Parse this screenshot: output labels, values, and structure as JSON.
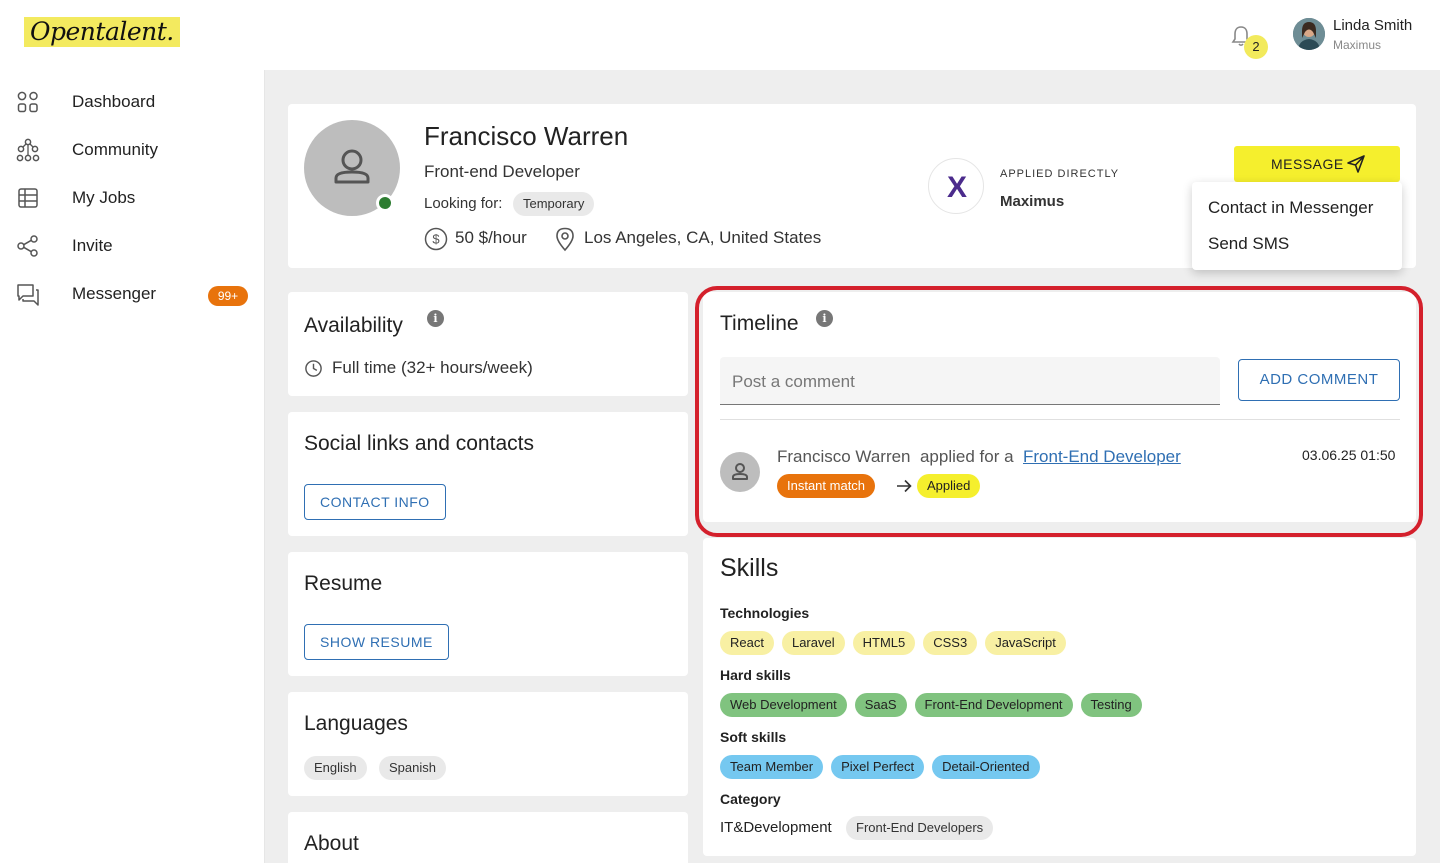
{
  "header": {
    "logo_text": "Opentalent.",
    "notification_count": "2",
    "user_name": "Linda Smith",
    "user_org": "Maximus"
  },
  "sidebar": {
    "items": [
      {
        "label": "Dashboard",
        "icon": "dashboard-icon"
      },
      {
        "label": "Community",
        "icon": "community-icon"
      },
      {
        "label": "My Jobs",
        "icon": "jobs-icon"
      },
      {
        "label": "Invite",
        "icon": "share-icon"
      },
      {
        "label": "Messenger",
        "icon": "messenger-icon",
        "badge": "99+"
      }
    ]
  },
  "profile": {
    "name": "Francisco Warren",
    "role": "Front-end Developer",
    "looking_for_label": "Looking for:",
    "looking_for_value": "Temporary",
    "rate": "50 $/hour",
    "location": "Los Angeles, CA, United States",
    "status": "online",
    "applied_label": "APPLIED DIRECTLY",
    "company": "Maximus",
    "company_logo_letter": "X",
    "message_button": "MESSAGE"
  },
  "message_menu": {
    "items": [
      "Contact in Messenger",
      "Send SMS"
    ]
  },
  "availability": {
    "title": "Availability",
    "value": "Full time (32+ hours/week)"
  },
  "social": {
    "title": "Social links and contacts",
    "button": "CONTACT INFO"
  },
  "resume": {
    "title": "Resume",
    "button": "SHOW RESUME"
  },
  "languages": {
    "title": "Languages",
    "items": [
      "English",
      "Spanish"
    ]
  },
  "about": {
    "title": "About"
  },
  "timeline": {
    "title": "Timeline",
    "comment_placeholder": "Post a comment",
    "add_comment_button": "ADD COMMENT",
    "event": {
      "actor": "Francisco Warren",
      "action": "applied for a",
      "job_link": "Front-End Developer",
      "date": "03.06.25 01:50",
      "from_status": "Instant match",
      "to_status": "Applied"
    }
  },
  "skills": {
    "title": "Skills",
    "technologies_label": "Technologies",
    "technologies": [
      "React",
      "Laravel",
      "HTML5",
      "CSS3",
      "JavaScript"
    ],
    "hard_label": "Hard skills",
    "hard": [
      "Web Development",
      "SaaS",
      "Front-End Development",
      "Testing"
    ],
    "soft_label": "Soft skills",
    "soft": [
      "Team Member",
      "Pixel Perfect",
      "Detail-Oriented"
    ],
    "category_label": "Category",
    "category_value": "IT&Development",
    "category_chip": "Front-End Developers"
  },
  "colors": {
    "accent_yellow": "#f5ef2d",
    "link_blue": "#2f6fb3",
    "badge_orange": "#e8730c",
    "highlight_red": "#d4202c"
  }
}
